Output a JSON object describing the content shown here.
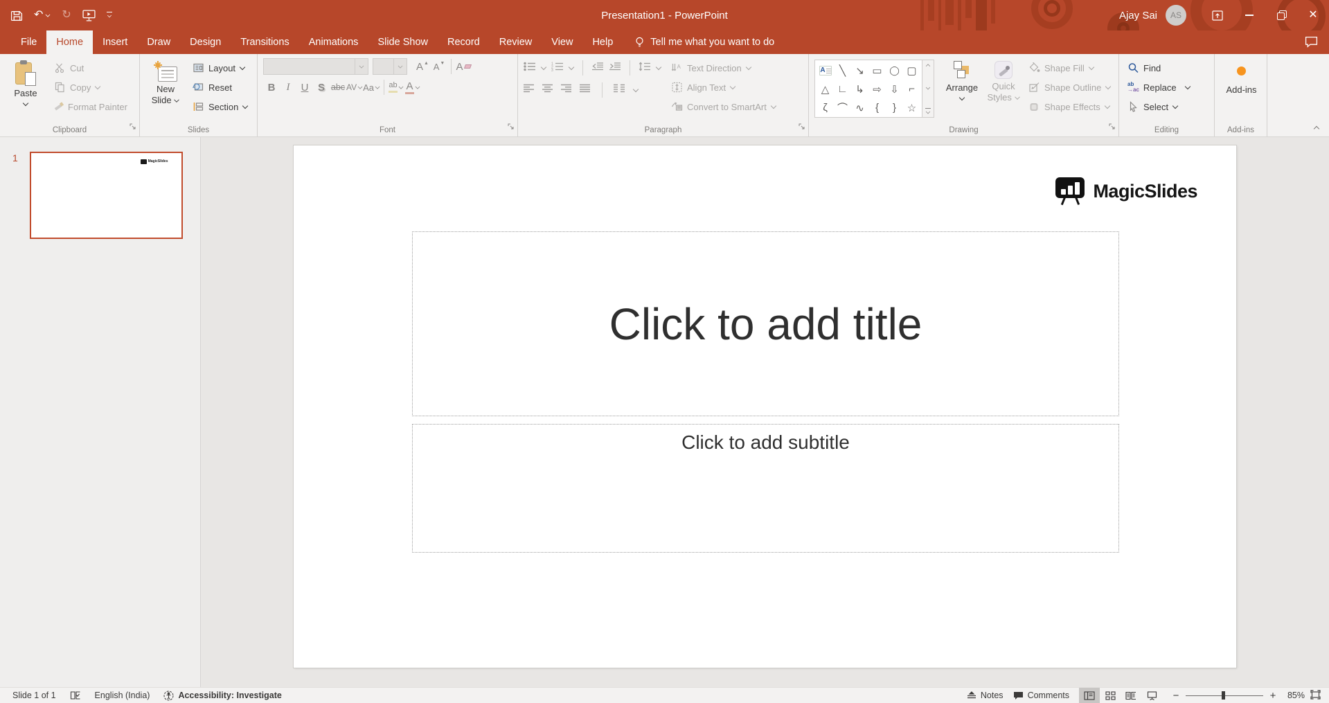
{
  "titlebar": {
    "title": "Presentation1 - PowerPoint",
    "user_name": "Ajay Sai",
    "user_initials": "AS"
  },
  "menu": {
    "tabs": [
      {
        "label": "File"
      },
      {
        "label": "Home"
      },
      {
        "label": "Insert"
      },
      {
        "label": "Draw"
      },
      {
        "label": "Design"
      },
      {
        "label": "Transitions"
      },
      {
        "label": "Animations"
      },
      {
        "label": "Slide Show"
      },
      {
        "label": "Record"
      },
      {
        "label": "Review"
      },
      {
        "label": "View"
      },
      {
        "label": "Help"
      }
    ],
    "tell_me": "Tell me what you want to do"
  },
  "ribbon": {
    "clipboard": {
      "label": "Clipboard",
      "paste": "Paste",
      "cut": "Cut",
      "copy": "Copy",
      "format_painter": "Format Painter"
    },
    "slides": {
      "label": "Slides",
      "new_slide_1": "New",
      "new_slide_2": "Slide",
      "layout": "Layout",
      "reset": "Reset",
      "section": "Section"
    },
    "font": {
      "label": "Font",
      "bold": "B",
      "italic": "I",
      "underline": "U",
      "shadow": "S",
      "strikethrough": "abc",
      "char_spacing": "AV",
      "change_case": "Aa",
      "highlight": "ab",
      "font_color": "A",
      "grow": "A",
      "shrink": "A",
      "clear": "A"
    },
    "paragraph": {
      "label": "Paragraph",
      "text_direction": "Text Direction",
      "align_text": "Align Text",
      "convert_smartart": "Convert to SmartArt"
    },
    "drawing": {
      "label": "Drawing",
      "arrange": "Arrange",
      "quick_1": "Quick",
      "quick_2": "Styles",
      "shape_fill": "Shape Fill",
      "shape_outline": "Shape Outline",
      "shape_effects": "Shape Effects",
      "shapes": [
        {
          "name": "text-box",
          "glyph": "A"
        },
        {
          "name": "line",
          "glyph": "╲"
        },
        {
          "name": "line-arrow",
          "glyph": "↘"
        },
        {
          "name": "rectangle",
          "glyph": "▭"
        },
        {
          "name": "oval",
          "glyph": "◯"
        },
        {
          "name": "rounded-rectangle",
          "glyph": "▢"
        },
        {
          "name": "isosceles-triangle",
          "glyph": "△"
        },
        {
          "name": "elbow-connector",
          "glyph": "∟"
        },
        {
          "name": "elbow-arrow-connector",
          "glyph": "↳"
        },
        {
          "name": "right-arrow",
          "glyph": "⇨"
        },
        {
          "name": "down-arrow",
          "glyph": "⇩"
        },
        {
          "name": "corner-shape",
          "glyph": "⌐"
        },
        {
          "name": "freeform-scribble",
          "glyph": "ζ"
        },
        {
          "name": "arc",
          "glyph": "⌒"
        },
        {
          "name": "curve",
          "glyph": "∿"
        },
        {
          "name": "left-brace",
          "glyph": "{"
        },
        {
          "name": "right-brace",
          "glyph": "}"
        },
        {
          "name": "star",
          "glyph": "☆"
        }
      ]
    },
    "editing": {
      "label": "Editing",
      "find": "Find",
      "replace": "Replace",
      "select": "Select"
    },
    "addins": {
      "label": "Add-ins",
      "button": "Add-ins"
    }
  },
  "thumbnail_panel": {
    "slide_number": "1"
  },
  "slide": {
    "brand": "MagicSlides",
    "title_placeholder": "Click to add title",
    "subtitle_placeholder": "Click to add subtitle"
  },
  "statusbar": {
    "slide_counter": "Slide 1 of 1",
    "language": "English (India)",
    "accessibility": "Accessibility: Investigate",
    "notes": "Notes",
    "comments": "Comments",
    "zoom_level": "85%"
  },
  "colors": {
    "accent": "#B7472A",
    "addin_dot": "#F7941E"
  }
}
